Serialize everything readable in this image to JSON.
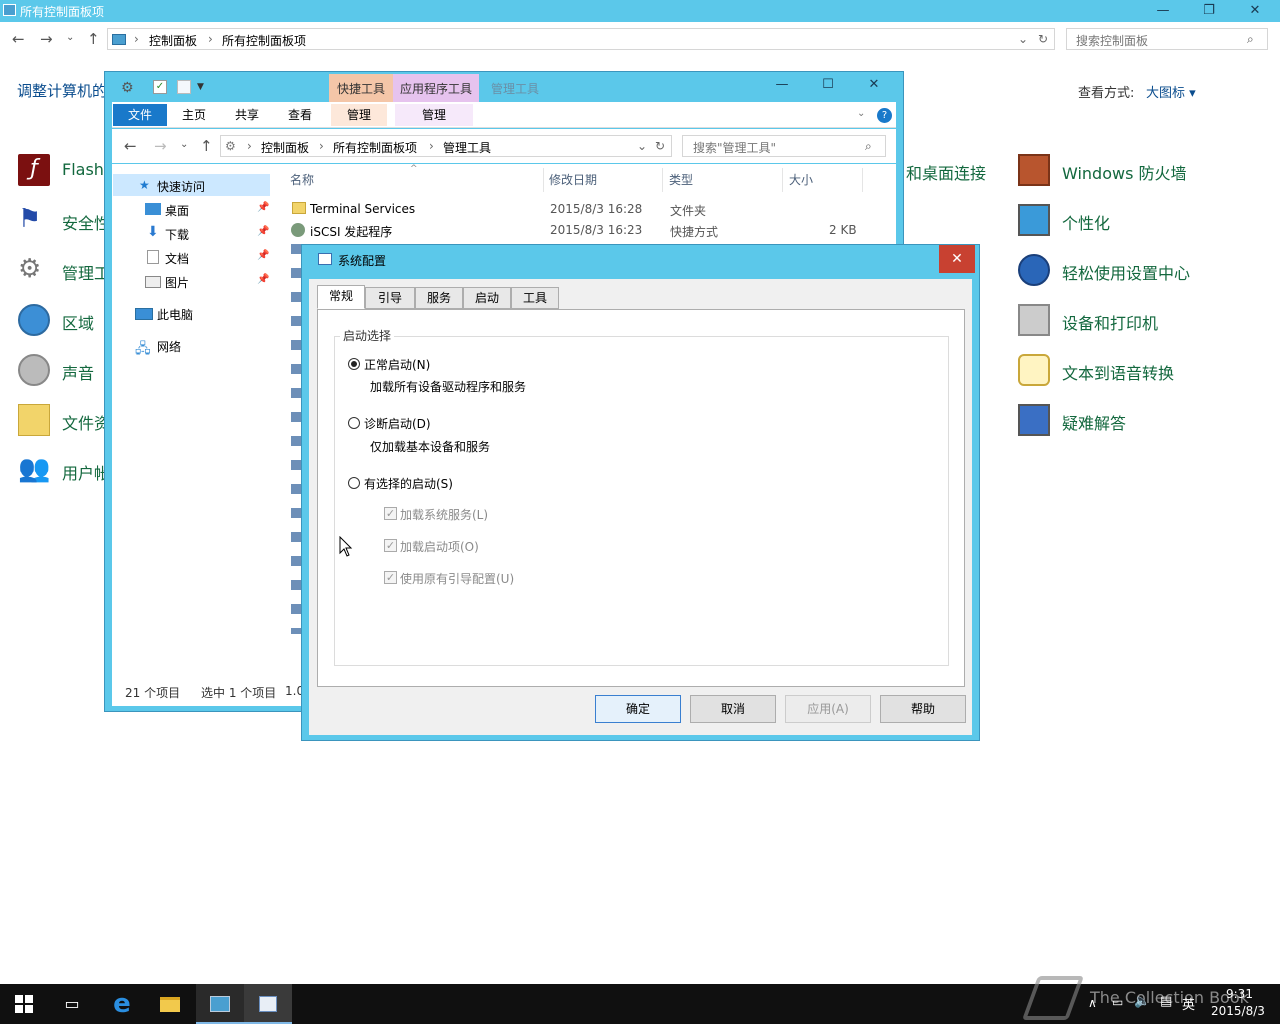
{
  "control_panel": {
    "title": "所有控制面板项",
    "breadcrumb": [
      "控制面板",
      "所有控制面板项"
    ],
    "search_placeholder": "搜索控制面板",
    "heading": "调整计算机的",
    "view_label": "查看方式:",
    "view_value": "大图标 ▾",
    "left_items": [
      "Flash",
      "安全性",
      "管理工",
      "区域",
      "声音",
      "文件资",
      "用户帐"
    ],
    "mid_item": "和桌面连接",
    "right_items": [
      "Windows 防火墙",
      "个性化",
      "轻松使用设置中心",
      "设备和打印机",
      "文本到语音转换",
      "疑难解答"
    ]
  },
  "explorer": {
    "title": "管理工具",
    "ctx_groups": [
      "快捷工具",
      "应用程序工具"
    ],
    "ribbon_tabs": [
      "文件",
      "主页",
      "共享",
      "查看",
      "管理",
      "管理"
    ],
    "breadcrumb": [
      "控制面板",
      "所有控制面板项",
      "管理工具"
    ],
    "search_placeholder": "搜索\"管理工具\"",
    "tree": {
      "quick_access": "快速访问",
      "desktop": "桌面",
      "downloads": "下载",
      "documents": "文档",
      "pictures": "图片",
      "this_pc": "此电脑",
      "network": "网络"
    },
    "columns": [
      "名称",
      "修改日期",
      "类型",
      "大小"
    ],
    "rows": [
      {
        "name": "Terminal Services",
        "date": "2015/8/3 16:28",
        "type": "文件夹",
        "size": ""
      },
      {
        "name": "iSCSI 发起程序",
        "date": "2015/8/3 16:23",
        "type": "快捷方式",
        "size": "2 KB"
      }
    ],
    "status_count": "21 个项目",
    "status_selected": "选中 1 个项目",
    "status_size": "1.0"
  },
  "dialog": {
    "title": "系统配置",
    "tabs": [
      "常规",
      "引导",
      "服务",
      "启动",
      "工具"
    ],
    "group_label": "启动选择",
    "normal": "正常启动(N)",
    "normal_desc": "加载所有设备驱动程序和服务",
    "diag": "诊断启动(D)",
    "diag_desc": "仅加载基本设备和服务",
    "selective": "有选择的启动(S)",
    "chk1": "加载系统服务(L)",
    "chk2": "加载启动项(O)",
    "chk3": "使用原有引导配置(U)",
    "ok": "确定",
    "cancel": "取消",
    "apply": "应用(A)",
    "help": "帮助"
  },
  "taskbar": {
    "time": "9:31",
    "date": "2015/8/3",
    "ime": "英",
    "watermark": "The Collection Book"
  }
}
